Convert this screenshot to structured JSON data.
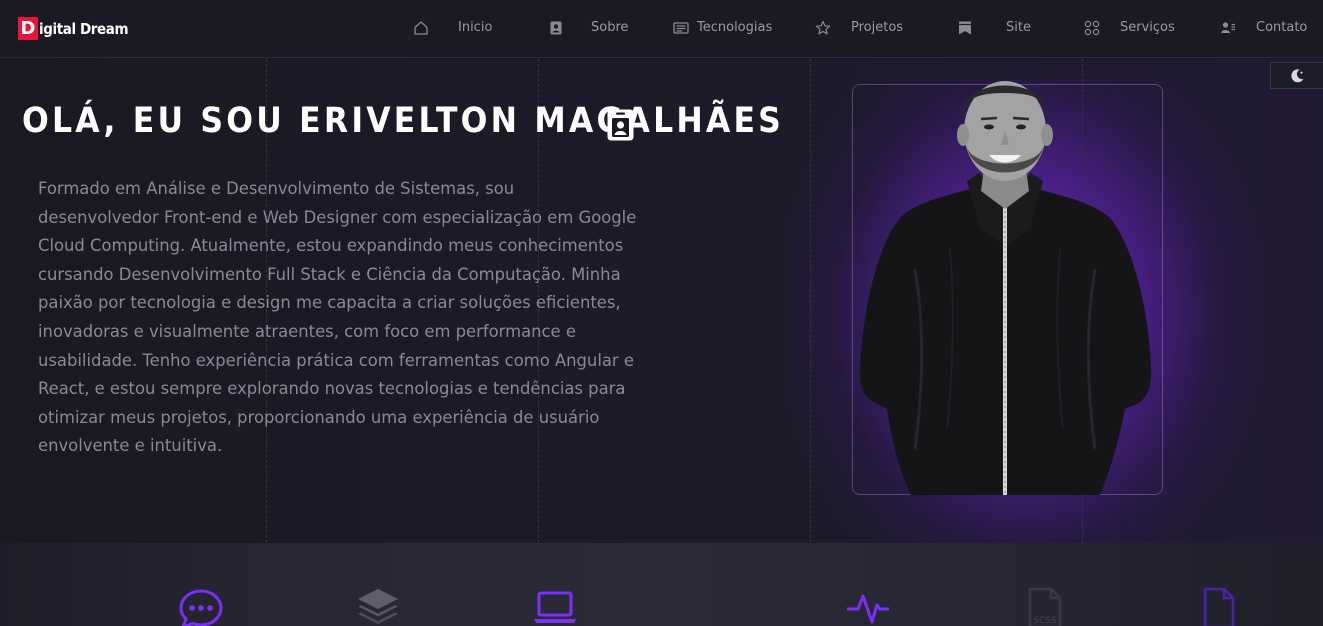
{
  "header": {
    "logo_letter": "D",
    "logo_text": "igital Dream",
    "nav": [
      {
        "label": "Inicio",
        "icon": "home-icon"
      },
      {
        "label": "Sobre",
        "icon": "person-card-icon"
      },
      {
        "label": "Tecnologias",
        "icon": "id-card-icon"
      },
      {
        "label": "Projetos",
        "icon": "star-icon"
      },
      {
        "label": "Site",
        "icon": "bookmark-icon"
      },
      {
        "label": "Serviços",
        "icon": "grid-icon"
      },
      {
        "label": "Contato",
        "icon": "contact-icon"
      }
    ]
  },
  "hero": {
    "title": "OLÁ, EU SOU ERIVELTON MAGALHÃES",
    "title_icon": "badge-icon",
    "paragraph": "Formado em Análise e Desenvolvimento de Sistemas, sou desenvolvedor Front-end e Web Designer com especialização em Google Cloud Computing. Atualmente, estou expandindo meus conhecimentos cursando Desenvolvimento Full Stack e Ciência da Computação. Minha paixão por tecnologia e design me capacita a criar soluções eficientes, inovadoras e visualmente atraentes, com foco em performance e usabilidade. Tenho experiência prática com ferramentas como Angular e React, e estou sempre explorando novas tecnologias e tendências para otimizar meus projetos, proporcionando uma experiência de usuário envolvente e intuitiva.",
    "photo_icon": "profile-photo",
    "theme_toggle_icon": "moon-icon"
  },
  "skills": {
    "icons": [
      "chat-icon",
      "layers-icon",
      "laptop-icon",
      "pulse-icon",
      "scss-file-icon",
      "file-icon"
    ],
    "scss_label": "SCSS"
  },
  "colors": {
    "accent": "#8a2be2",
    "logo_red": "#e8143d",
    "background": "#191923",
    "text_muted": "#8a8a96"
  }
}
